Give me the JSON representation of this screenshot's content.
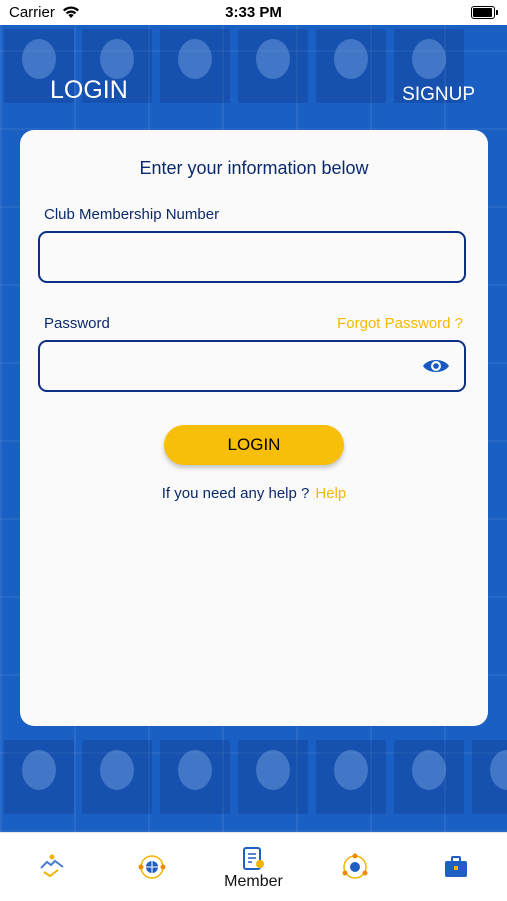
{
  "status_bar": {
    "carrier": "Carrier",
    "time": "3:33 PM"
  },
  "tabs": {
    "login_label": "LOGIN",
    "signup_label": "SIGNUP"
  },
  "form": {
    "headline": "Enter your information below",
    "membership_label": "Club Membership Number",
    "membership_value": "",
    "password_label": "Password",
    "password_value": "",
    "forgot_label": "Forgot Password ?",
    "login_button": "LOGIN",
    "help_question": "If you need any help ?",
    "help_link": "Help"
  },
  "bottom_nav": {
    "active_label": "Member",
    "items": [
      {
        "icon": "handshake-icon"
      },
      {
        "icon": "globe-people-icon"
      },
      {
        "icon": "member-card-icon"
      },
      {
        "icon": "network-icon"
      },
      {
        "icon": "briefcase-icon"
      }
    ]
  },
  "colors": {
    "brand_blue": "#1a5fc4",
    "navy": "#0b2a6b",
    "accent_yellow": "#f7be0a"
  }
}
